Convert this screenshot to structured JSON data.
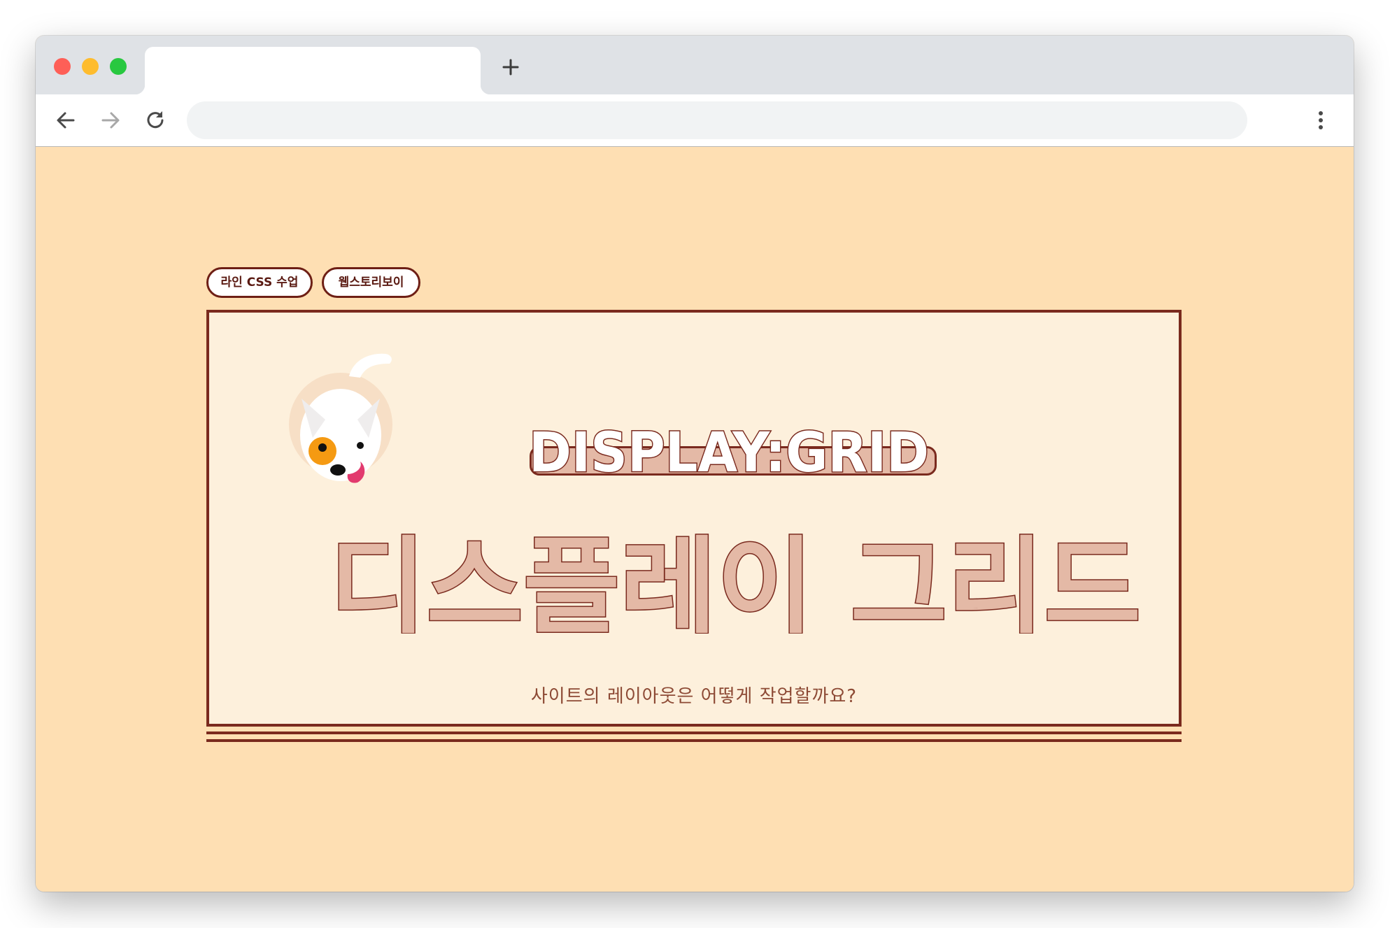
{
  "browser": {
    "tab_title": "",
    "address": "",
    "colors": {
      "traffic_red": "#fe5f57",
      "traffic_yellow": "#febc2e",
      "traffic_green": "#28c840",
      "tabstrip": "#dfe2e6"
    },
    "icons": {
      "back": "arrow-left-icon",
      "forward": "arrow-right-icon",
      "reload": "reload-icon",
      "menu": "vertical-dots-icon",
      "new_tab": "plus-icon"
    }
  },
  "page": {
    "tags": [
      "라인 CSS 수업",
      "웹스토리보이"
    ],
    "title_en": "DISPLAY:GRID",
    "title_ko": "디스플레이 그리드",
    "subtitle": "사이트의 레이아웃은 어떻게 작업할까요?",
    "colors": {
      "background": "#fedfb3",
      "card": "#fdf0dc",
      "outline": "#7a2a1e",
      "accent_fill": "#e4b9a6",
      "subtitle": "#8d4a35"
    },
    "illustration": "dog-mascot-icon"
  }
}
